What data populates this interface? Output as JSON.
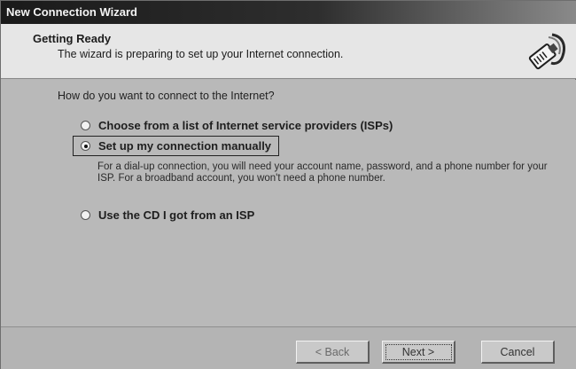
{
  "window": {
    "title": "New Connection Wizard"
  },
  "header": {
    "title": "Getting Ready",
    "subtitle": "The wizard is preparing to set up your Internet connection.",
    "icon": "network-cable-icon"
  },
  "body": {
    "question": "How do you want to connect to the Internet?",
    "options": [
      {
        "label": "Choose from a list of Internet service providers (ISPs)",
        "selected": false
      },
      {
        "label": "Set up my connection manually",
        "selected": true
      },
      {
        "label": "Use the CD I got from an ISP",
        "selected": false
      }
    ],
    "manual_description": "For a dial-up connection, you will need your account name, password, and a phone number for your ISP. For a broadband account, you won't need a phone number."
  },
  "footer": {
    "back_label": "< Back",
    "next_label": "Next >",
    "cancel_label": "Cancel"
  }
}
